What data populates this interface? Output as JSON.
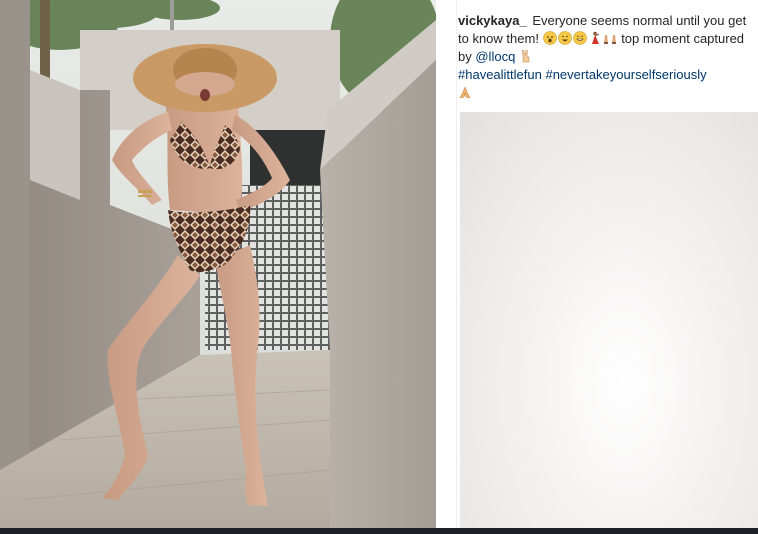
{
  "post": {
    "username": "vickykaya_",
    "caption_text_1": "Everyone seems normal until you get to know them!",
    "caption_text_2": "top moment captured by",
    "mention": "@llocq",
    "hashtags": [
      "#havealittlefun",
      "#nevertakeyourselfseriously"
    ],
    "emojis_line1": [
      "hushed-face-emoji",
      "rolling-laughing-emoji",
      "grinning-face-emoji",
      "dancer-emoji",
      "raising-hands-emoji"
    ],
    "emoji_after_mention": "victory-hand-emoji",
    "emoji_end": "folded-hands-emoji"
  },
  "colors": {
    "username": "#262626",
    "text": "#262626",
    "link": "#00376b",
    "bottom_strip": "#1d2127"
  }
}
